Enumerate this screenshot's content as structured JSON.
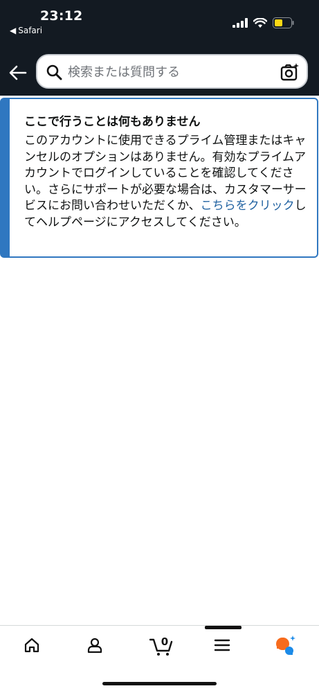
{
  "status_bar": {
    "time": "23:12",
    "back_app": "Safari"
  },
  "search": {
    "placeholder": "検索または質問する"
  },
  "alert": {
    "title": "ここで行うことは何もありません",
    "body_before_link": "このアカウントに使用できるプライム管理またはキャンセルのオプションはありません。有効なプライムアカウントでログインしていることを確認してください。さらにサポートが必要な場合は、カスタマーサービスにお問い合わせいただくか、",
    "link_text": "こちらをクリック",
    "body_after_link": "してヘルプページにアクセスしてください。"
  },
  "bottom_nav": {
    "cart_count": "0"
  },
  "colors": {
    "header_bg": "#131a22",
    "alert_border": "#2f77c0",
    "link": "#2162a1",
    "battery": "#ffd814",
    "ai_orange": "#f76b1c",
    "ai_blue": "#1c8be8"
  }
}
